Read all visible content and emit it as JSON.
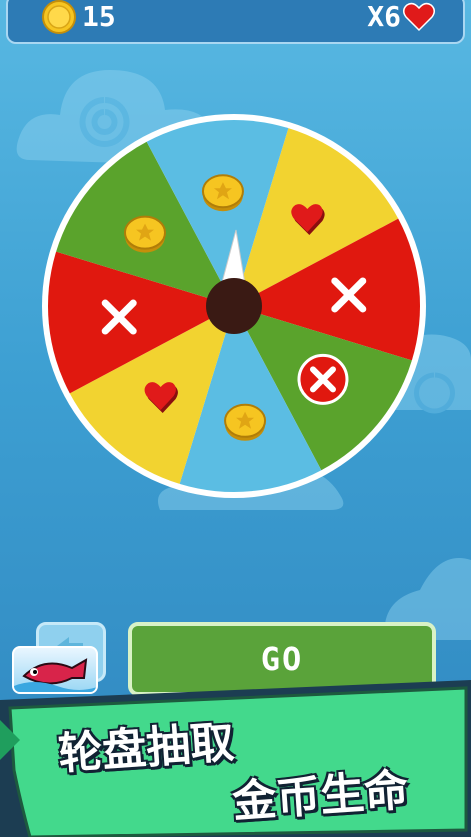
{
  "hud": {
    "coins": "15",
    "lives": "X6"
  },
  "wheel": {
    "segments": [
      {
        "color": "#f2d330",
        "prize": "heart"
      },
      {
        "color": "#e0180f",
        "prize": "x"
      },
      {
        "color": "#5aa32c",
        "prize": "x-badge"
      },
      {
        "color": "#5bbde3",
        "prize": "coin"
      },
      {
        "color": "#f2d330",
        "prize": "heart"
      },
      {
        "color": "#e0180f",
        "prize": "x"
      },
      {
        "color": "#5aa32c",
        "prize": "coin"
      },
      {
        "color": "#5bbde3",
        "prize": "coin"
      }
    ]
  },
  "actions": {
    "go_label": "GO"
  },
  "promo": {
    "line1": "轮盘抽取",
    "line2": "金币生命"
  },
  "colors": {
    "go_green": "#5aa33a",
    "banner_green": "#43d98c",
    "topbar": "#2d7bb5"
  }
}
